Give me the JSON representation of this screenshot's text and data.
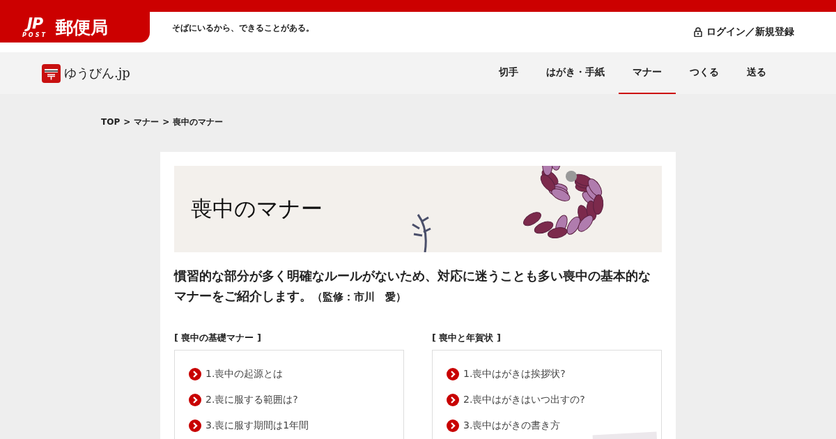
{
  "brand": {
    "mark": "JP",
    "sub": "POST",
    "name": "郵便局"
  },
  "tagline": "そばにいるから、できることがある。",
  "login": "ログイン／新規登録",
  "site": {
    "name": "ゆうびん.jp"
  },
  "nav": [
    {
      "label": "切手",
      "selected": false
    },
    {
      "label": "はがき・手紙",
      "selected": false
    },
    {
      "label": "マナー",
      "selected": true
    },
    {
      "label": "つくる",
      "selected": false
    },
    {
      "label": "送る",
      "selected": false
    }
  ],
  "breadcrumb": [
    "TOP",
    "マナー",
    "喪中のマナー"
  ],
  "breadcrumb_separator": ">",
  "banner": {
    "title": "喪中のマナー"
  },
  "lede": "慣習的な部分が多く明確なルールがないため、対応に迷うことも多い喪中の基本的なマナーをご紹介します。",
  "supervisor": "（監修：市川　愛）",
  "sections": [
    {
      "title": "[ 喪中の基礎マナー ]",
      "links": [
        "1.喪中の起源とは",
        "2.喪に服する範囲は?",
        "3.喪に服す期間は1年間"
      ],
      "has_photo": false
    },
    {
      "title": "[ 喪中と年賀状 ]",
      "links": [
        "1.喪中はがきは挨拶状?",
        "2.喪中はがきはいつ出すの?",
        "3.喪中はがきの書き方"
      ],
      "has_photo": true
    }
  ]
}
